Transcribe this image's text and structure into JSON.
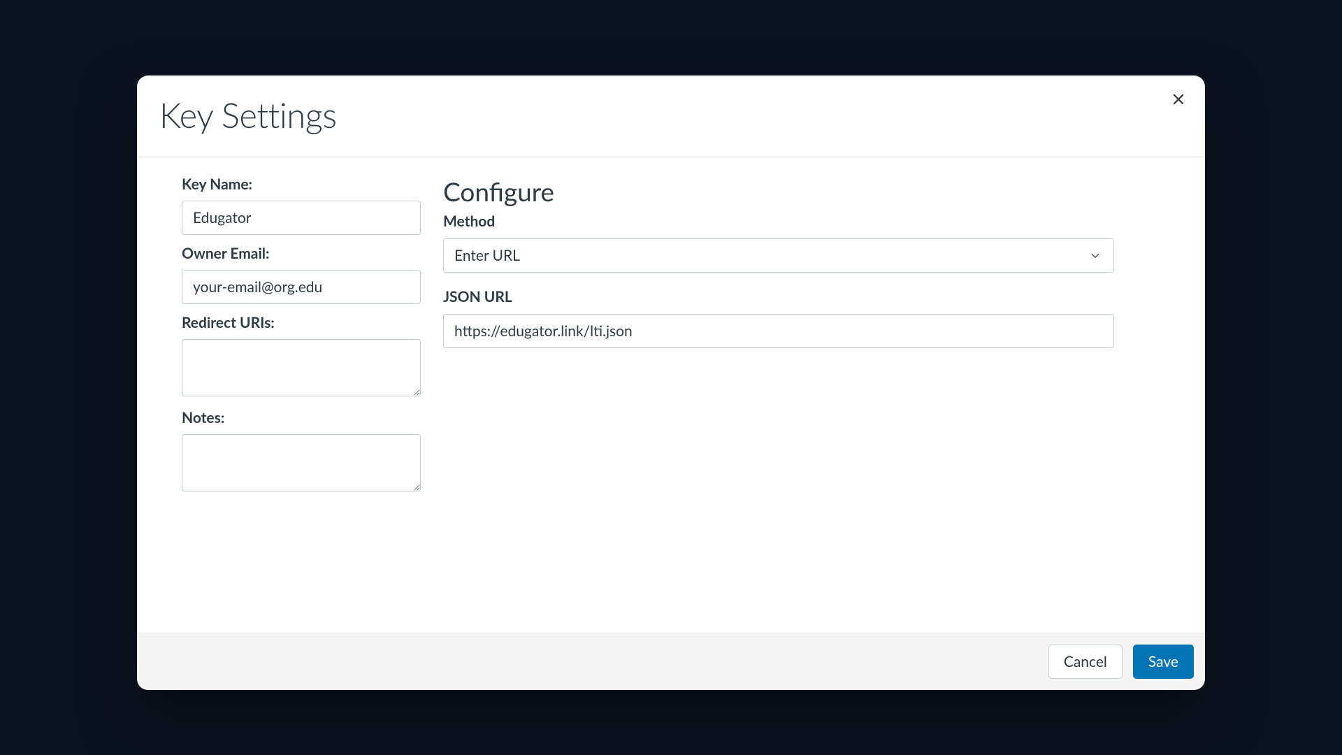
{
  "modal": {
    "title": "Key Settings"
  },
  "left": {
    "key_name_label": "Key Name:",
    "key_name_value": "Edugator",
    "owner_email_label": "Owner Email:",
    "owner_email_value": "your-email@org.edu",
    "redirect_uris_label": "Redirect URIs:",
    "redirect_uris_value": "",
    "notes_label": "Notes:",
    "notes_value": ""
  },
  "right": {
    "configure_title": "Configure",
    "method_label": "Method",
    "method_value": "Enter URL",
    "json_url_label": "JSON URL",
    "json_url_value": "https://edugator.link/lti.json"
  },
  "footer": {
    "cancel_label": "Cancel",
    "save_label": "Save"
  }
}
